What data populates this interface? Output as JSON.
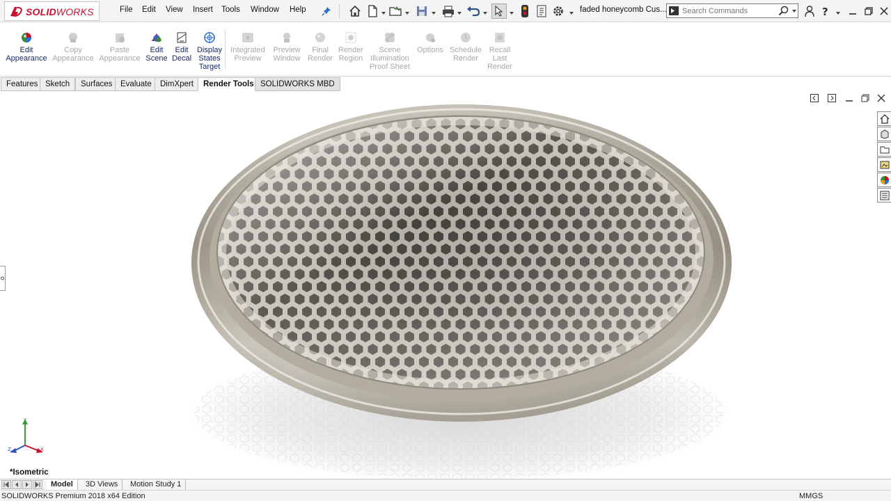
{
  "app": {
    "brand": "SOLIDWORKS",
    "document_title": "faded honeycomb Cus..."
  },
  "menu": [
    "File",
    "Edit",
    "View",
    "Insert",
    "Tools",
    "Window",
    "Help"
  ],
  "toolbar_icons": [
    "home-icon",
    "new-document-icon",
    "open-folder-icon",
    "save-icon",
    "print-icon",
    "undo-icon",
    "select-arrow-icon",
    "rebuild-traffic-light-icon",
    "file-properties-icon",
    "options-gear-icon"
  ],
  "search": {
    "placeholder": "Search Commands"
  },
  "window_controls": [
    "user-icon",
    "help-icon",
    "minimize-icon",
    "restore-icon",
    "close-icon"
  ],
  "command_manager": {
    "items": [
      {
        "id": "edit-appearance",
        "lines": [
          "Edit",
          "Appearance"
        ],
        "enabled": true,
        "icon": "appearance-ball-icon"
      },
      {
        "id": "copy-appearance",
        "lines": [
          "Copy",
          "Appearance"
        ],
        "enabled": false,
        "icon": "copy-appearance-icon"
      },
      {
        "id": "paste-appearance",
        "lines": [
          "Paste",
          "Appearance"
        ],
        "enabled": false,
        "icon": "paste-appearance-icon"
      },
      {
        "id": "edit-scene",
        "lines": [
          "Edit",
          "Scene"
        ],
        "enabled": true,
        "icon": "scene-icon"
      },
      {
        "id": "edit-decal",
        "lines": [
          "Edit",
          "Decal"
        ],
        "enabled": true,
        "icon": "decal-icon"
      },
      {
        "id": "display-states-target",
        "lines": [
          "Display",
          "States",
          "Target"
        ],
        "enabled": true,
        "icon": "display-states-icon"
      },
      {
        "id": "integrated-preview",
        "lines": [
          "Integrated",
          "Preview"
        ],
        "enabled": false,
        "icon": "integrated-preview-icon"
      },
      {
        "id": "preview-window",
        "lines": [
          "Preview",
          "Window"
        ],
        "enabled": false,
        "icon": "preview-window-icon"
      },
      {
        "id": "final-render",
        "lines": [
          "Final",
          "Render"
        ],
        "enabled": false,
        "icon": "final-render-icon"
      },
      {
        "id": "render-region",
        "lines": [
          "Render",
          "Region"
        ],
        "enabled": false,
        "icon": "render-region-icon"
      },
      {
        "id": "scene-illumination-proof-sheet",
        "lines": [
          "Scene",
          "Illumination",
          "Proof Sheet"
        ],
        "enabled": false,
        "icon": "proof-sheet-icon"
      },
      {
        "id": "options",
        "lines": [
          "Options"
        ],
        "enabled": false,
        "icon": "options-icon"
      },
      {
        "id": "schedule-render",
        "lines": [
          "Schedule",
          "Render"
        ],
        "enabled": false,
        "icon": "schedule-render-icon"
      },
      {
        "id": "recall-last-render",
        "lines": [
          "Recall",
          "Last",
          "Render"
        ],
        "enabled": false,
        "icon": "recall-render-icon"
      }
    ]
  },
  "tabs": [
    {
      "label": "Features",
      "active": false
    },
    {
      "label": "Sketch",
      "active": false
    },
    {
      "label": "Surfaces",
      "active": false
    },
    {
      "label": "Evaluate",
      "active": false
    },
    {
      "label": "DimXpert",
      "active": false
    },
    {
      "label": "Render Tools",
      "active": true
    },
    {
      "label": "SOLIDWORKS MBD",
      "active": false
    }
  ],
  "viewport": {
    "view_name": "*Isometric",
    "triad_labels": {
      "x": "X",
      "y": "Y",
      "z": "Z"
    },
    "task_pane_icons": [
      "solidworks-resources-icon",
      "design-library-icon",
      "file-explorer-icon",
      "view-palette-icon",
      "appearances-scenes-icon",
      "custom-properties-icon"
    ]
  },
  "bottom_tabs": [
    {
      "label": "Model",
      "active": true
    },
    {
      "label": "3D Views",
      "active": false
    },
    {
      "label": "Motion Study 1",
      "active": false
    }
  ],
  "status": {
    "edition": "SOLIDWORKS Premium 2018 x64 Edition",
    "units": "MMGS"
  },
  "colors": {
    "brand_red": "#c8102e",
    "command_text": "#1a2a66",
    "disabled_text": "#a8a8a8"
  }
}
